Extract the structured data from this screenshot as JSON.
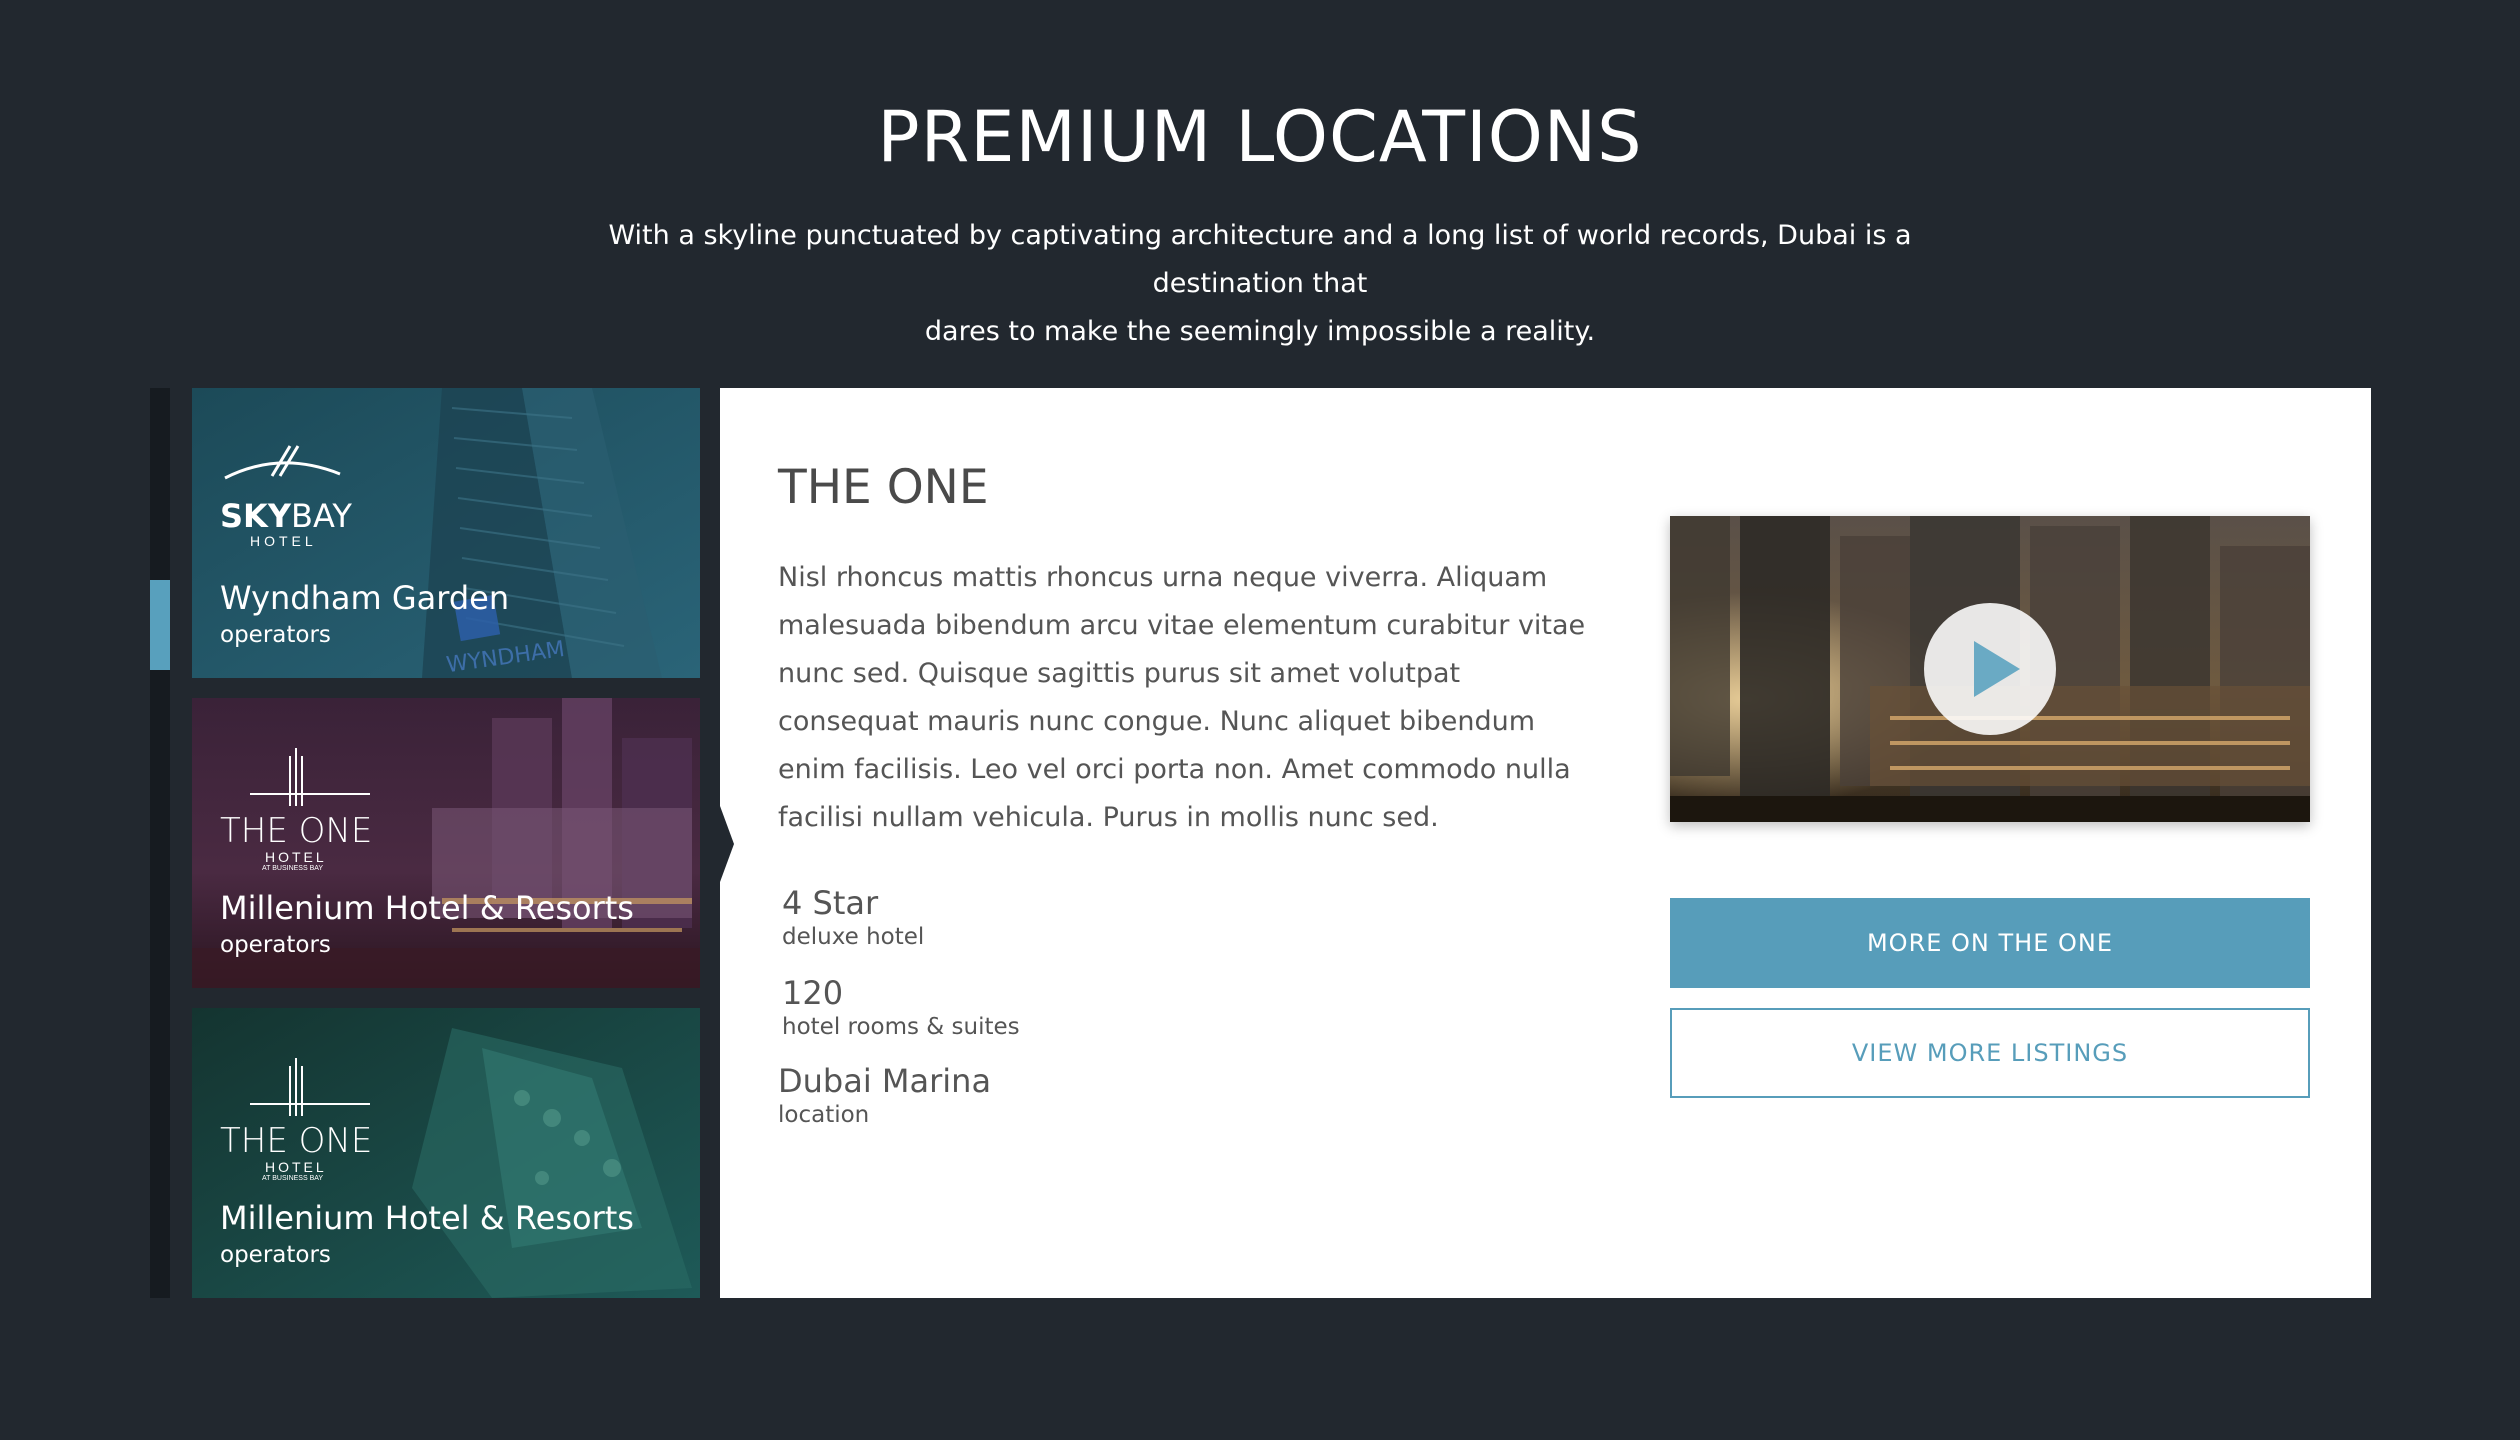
{
  "header": {
    "title": "PREMIUM LOCATIONS",
    "subtitle_line1": "With a skyline punctuated by captivating architecture and a long list of world records, Dubai is a destination that",
    "subtitle_line2": "dares to make the seemingly impossible a reality."
  },
  "colors": {
    "background": "#22282f",
    "accent": "#579dba",
    "panel": "#ffffff",
    "text_dark": "#4a4a4a"
  },
  "cards": [
    {
      "logo_bold": "SKY",
      "logo_light": "BAY",
      "logo_sub": "HOTEL",
      "sign_text": "WYNDHAM",
      "name": "Wyndham Garden",
      "subtitle": "operators",
      "active": true
    },
    {
      "logo_main": "THE ONE",
      "logo_sub": "HOTEL",
      "logo_small": "AT BUSINESS BAY",
      "name": "Millenium Hotel & Resorts",
      "subtitle": "operators",
      "active": false
    },
    {
      "logo_main": "THE ONE",
      "logo_sub": "HOTEL",
      "logo_small": "AT BUSINESS BAY",
      "name": "Millenium Hotel & Resorts",
      "subtitle": "operators",
      "active": false
    }
  ],
  "detail": {
    "title": "THE ONE",
    "description": "Nisl rhoncus mattis rhoncus urna neque viverra. Aliquam malesuada bibendum arcu vitae elementum curabitur vitae nunc sed. Quisque sagittis purus sit amet volutpat consequat mauris nunc congue. Nunc aliquet bibendum enim facilisis. Leo vel orci porta non. Amet commodo nulla facilisi nullam vehicula. Purus in mollis nunc sed.",
    "stats": [
      {
        "value": "4 Star",
        "label": "deluxe hotel"
      },
      {
        "value": "120",
        "label": "hotel rooms & suites"
      },
      {
        "value": "Dubai Marina",
        "label": "location"
      }
    ],
    "video_icon": "play-icon",
    "primary_button": "MORE ON THE ONE",
    "secondary_button": "VIEW MORE LISTINGS"
  }
}
